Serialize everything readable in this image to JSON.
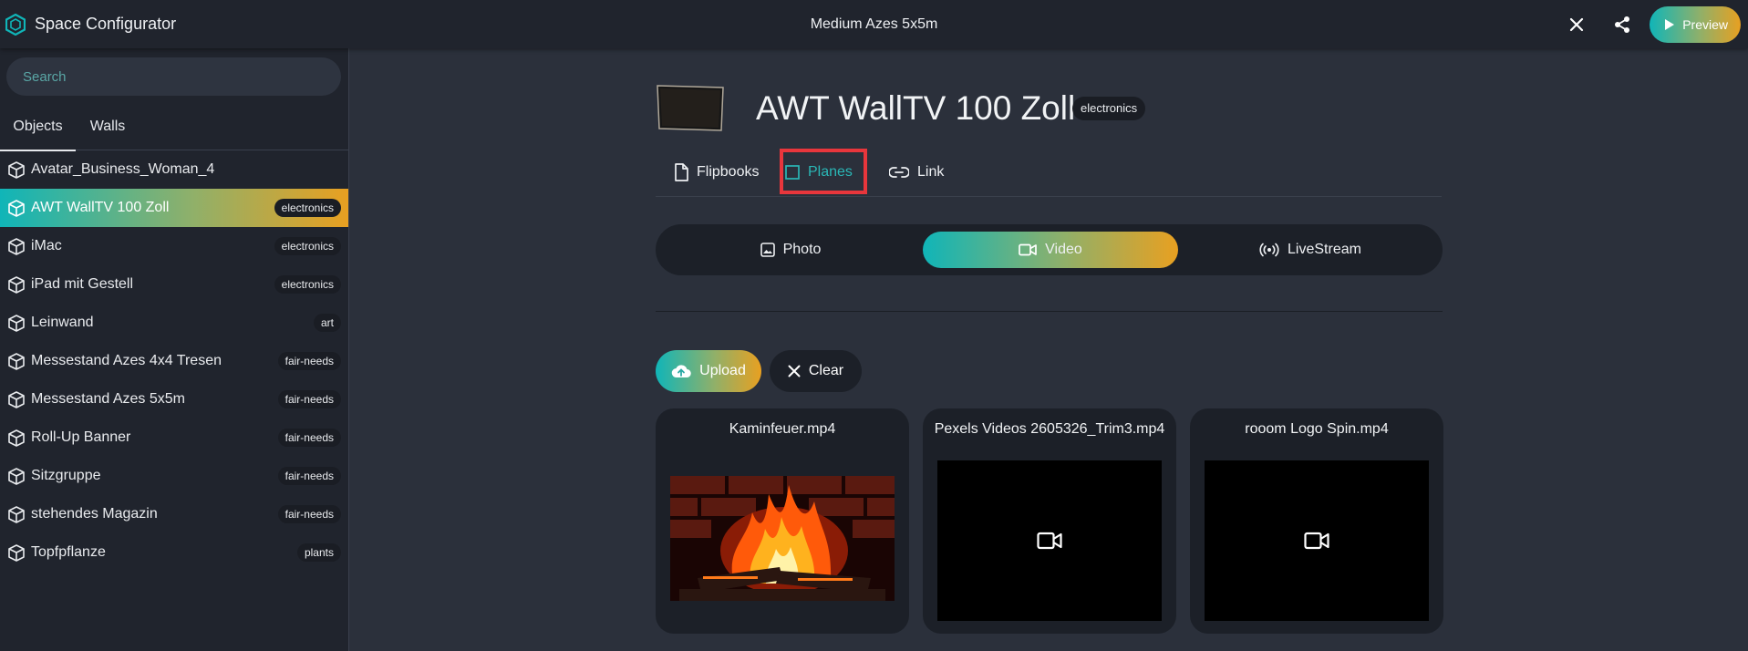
{
  "app": {
    "title": "Space Configurator",
    "window_title": "Medium Azes 5x5m",
    "preview_label": "Preview",
    "brand_color": "#10b5b8",
    "accent_gradient": [
      "#10b5b8",
      "#e8a021"
    ]
  },
  "sidebar": {
    "search_placeholder": "Search",
    "tabs": [
      {
        "label": "Objects",
        "active": true
      },
      {
        "label": "Walls",
        "active": false
      }
    ],
    "items": [
      {
        "label": "Avatar_Business_Woman_4",
        "badge": ""
      },
      {
        "label": "AWT WallTV 100 Zoll",
        "badge": "electronics",
        "selected": true
      },
      {
        "label": "iMac",
        "badge": "electronics"
      },
      {
        "label": "iPad mit Gestell",
        "badge": "electronics"
      },
      {
        "label": "Leinwand",
        "badge": "art"
      },
      {
        "label": "Messestand Azes 4x4 Tresen",
        "badge": "fair-needs"
      },
      {
        "label": "Messestand Azes 5x5m",
        "badge": "fair-needs"
      },
      {
        "label": "Roll-Up Banner",
        "badge": "fair-needs"
      },
      {
        "label": "Sitzgruppe",
        "badge": "fair-needs"
      },
      {
        "label": "stehendes Magazin",
        "badge": "fair-needs"
      },
      {
        "label": "Topfpflanze",
        "badge": "plants"
      }
    ]
  },
  "object": {
    "title": "AWT WallTV 100 Zoll",
    "category": "electronics",
    "tabs": [
      {
        "label": "Flipbooks",
        "icon": "document-icon"
      },
      {
        "label": "Planes",
        "icon": "square-icon",
        "active": true
      },
      {
        "label": "Link",
        "icon": "link-icon"
      }
    ],
    "media_types": [
      {
        "label": "Photo",
        "icon": "image-icon"
      },
      {
        "label": "Video",
        "icon": "video-camera-icon",
        "active": true
      },
      {
        "label": "LiveStream",
        "icon": "broadcast-icon"
      }
    ],
    "actions": {
      "upload_label": "Upload",
      "clear_label": "Clear"
    },
    "videos": [
      {
        "filename": "Kaminfeuer.mp4",
        "selected": true,
        "thumbnail": "fireplace-thumbnail"
      },
      {
        "filename": "Pexels Videos 2605326_Trim3.mp4",
        "selected": false,
        "thumbnail": "video-camera-icon"
      },
      {
        "filename": "rooom Logo Spin.mp4",
        "selected": false,
        "thumbnail": "video-camera-icon"
      }
    ],
    "highlight_color": "#e8363c"
  }
}
